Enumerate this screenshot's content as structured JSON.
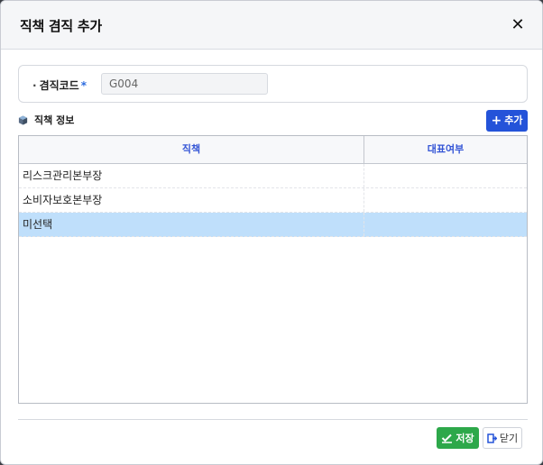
{
  "dialog": {
    "title": "직책 겸직 추가",
    "close_symbol": "✕"
  },
  "form": {
    "code_label": "겸직코드",
    "required_mark": "*",
    "code_value": "G004"
  },
  "section": {
    "title": "직책 정보",
    "add_label": "추가"
  },
  "grid": {
    "columns": [
      "직책",
      "대표여부"
    ],
    "rows": [
      {
        "position": "리스크관리본부장",
        "representative": ""
      },
      {
        "position": "소비자보호본부장",
        "representative": ""
      },
      {
        "position": "미선택",
        "representative": ""
      }
    ],
    "selected_row_color": "#bfdffb"
  },
  "footer": {
    "save_label": "저장",
    "close_label": "닫기"
  },
  "colors": {
    "accent": "#2453d9",
    "save": "#2da84a",
    "header_text": "#3556d6"
  }
}
